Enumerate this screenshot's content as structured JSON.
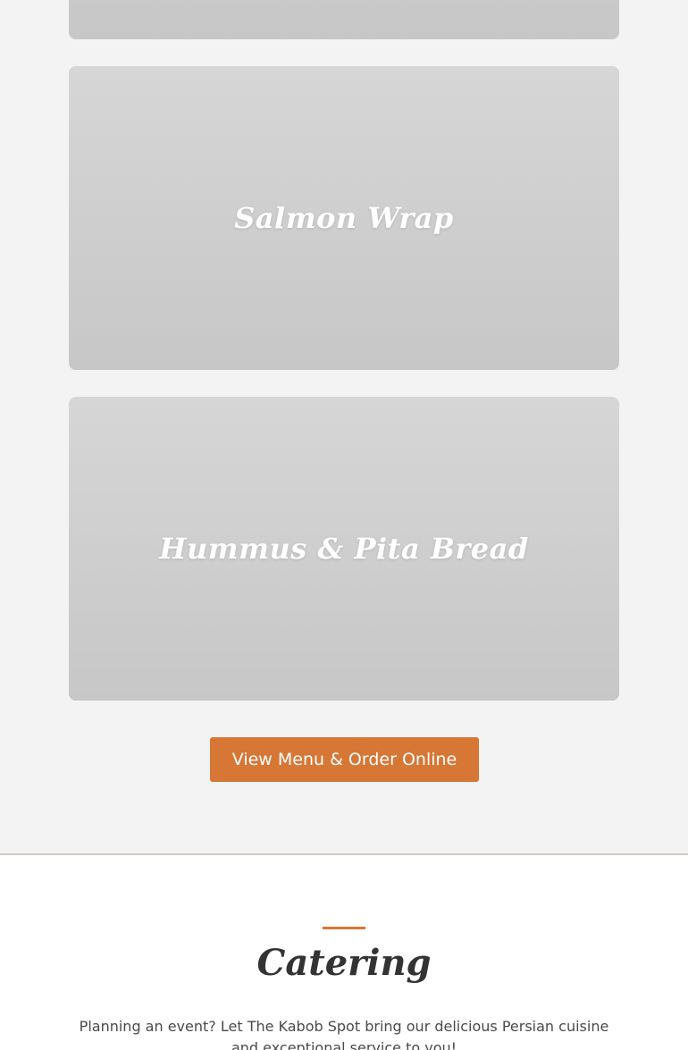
{
  "menu": {
    "items": [
      {
        "title": ""
      },
      {
        "title": "Salmon Wrap"
      },
      {
        "title": "Hummus & Pita Bread"
      }
    ],
    "cta_label": "View Menu & Order Online"
  },
  "catering": {
    "title": "Catering",
    "text": "Planning an event? Let The Kabob Spot bring our delicious Persian cuisine and exceptional service to you!"
  },
  "colors": {
    "accent": "#d67735",
    "page_background": "#f3f3f3",
    "card_background": "#cccccc",
    "heading": "#333333",
    "divider": "#cfcac3"
  }
}
